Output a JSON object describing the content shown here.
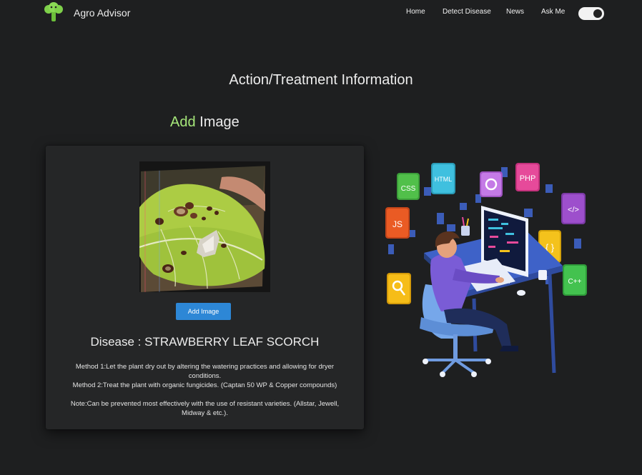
{
  "app": {
    "title": "Agro Advisor",
    "logo_icon": "broccoli-icon"
  },
  "nav": {
    "items": [
      {
        "label": "Home"
      },
      {
        "label": "Detect Disease"
      },
      {
        "label": "News"
      },
      {
        "label": "Ask Me"
      }
    ],
    "theme_toggle_on": true
  },
  "page": {
    "section_title": "Action/Treatment Information",
    "add_image_heading": {
      "accent": "Add",
      "rest": " Image"
    }
  },
  "card": {
    "uploaded_image": "strawberry-leaf-photo",
    "button_label": "Add Image",
    "disease_text": "Disease : STRAWBERRY LEAF SCORCH",
    "method1": "Method 1:Let the plant dry out by altering the watering practices and allowing for dryer conditions.",
    "method2": "Method 2:Treat the plant with organic fungicides. (Captan 50 WP & Copper compounds)",
    "note": "Note:Can be prevented most effectively with the use of resistant varieties. (Allstar, Jewell, Midway & etc.)."
  },
  "illustration": {
    "icon": "programmer-illustration",
    "tiles": [
      "CSS",
      "HTML",
      "PHP",
      "JS",
      "C++"
    ]
  },
  "colors": {
    "background": "#1e1f20",
    "card": "#252627",
    "accent_green": "#a6e77a",
    "button_blue": "#2d87d6"
  }
}
